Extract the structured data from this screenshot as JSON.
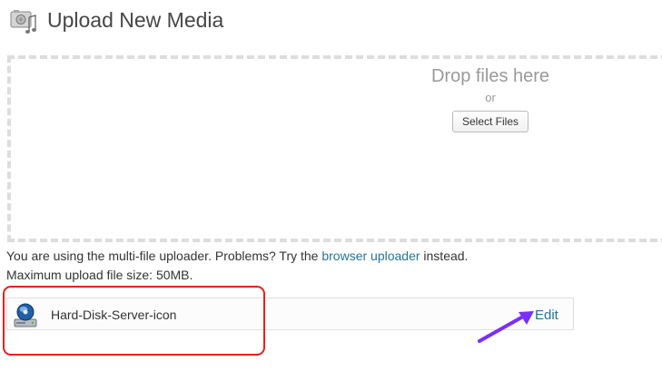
{
  "header": {
    "title": "Upload New Media",
    "icon": "media-upload-icon"
  },
  "dropzone": {
    "label": "Drop files here",
    "or_text": "or",
    "select_button": "Select Files"
  },
  "info": {
    "line1_prefix": "You are using the multi-file uploader. Problems? Try the ",
    "line1_link": "browser uploader",
    "line1_suffix": " instead.",
    "line2": "Maximum upload file size: 50MB."
  },
  "uploaded_files": [
    {
      "name": "Hard-Disk-Server-icon",
      "icon": "hard-disk-server-icon",
      "action_label": "Edit"
    }
  ],
  "annotations": {
    "highlight_color": "#e8211a",
    "arrow_color": "#7b2ff7"
  },
  "colors": {
    "link": "#21759b",
    "title": "#464646",
    "dropzone_border": "#dddddd"
  }
}
